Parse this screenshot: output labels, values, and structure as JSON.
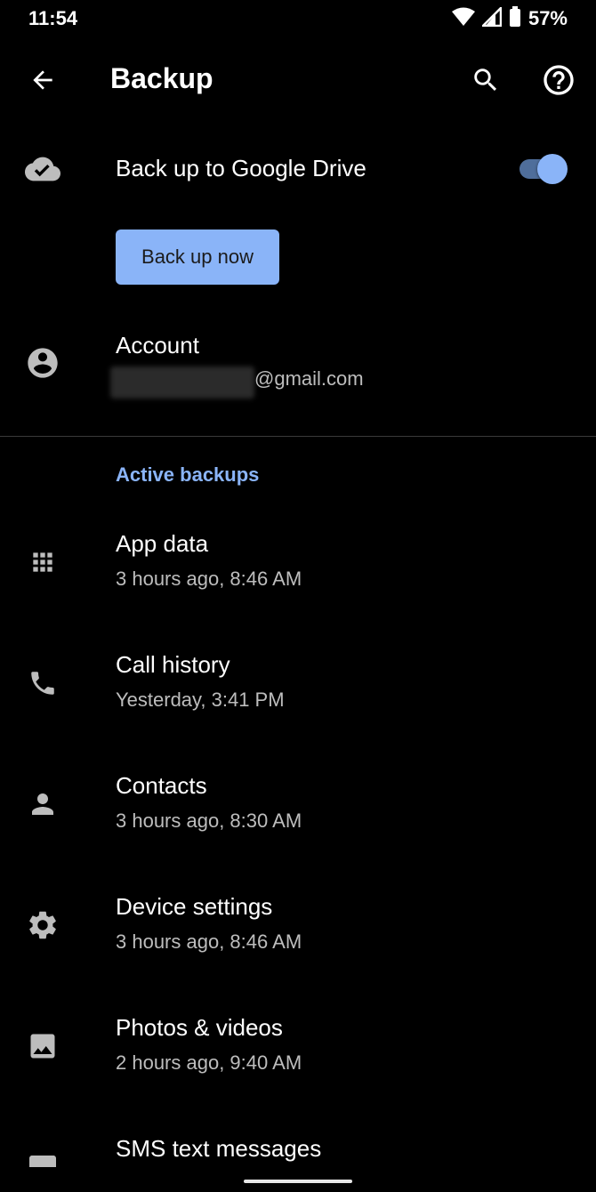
{
  "status_bar": {
    "time": "11:54",
    "battery": "57%"
  },
  "app_bar": {
    "title": "Backup"
  },
  "drive_backup": {
    "label": "Back up to Google Drive",
    "enabled": true
  },
  "backup_now": {
    "label": "Back up now"
  },
  "account": {
    "label": "Account",
    "email_suffix": "@gmail.com"
  },
  "section": {
    "header": "Active backups"
  },
  "backups": [
    {
      "name": "App data",
      "time": "3 hours ago, 8:46 AM",
      "icon": "apps-grid-icon"
    },
    {
      "name": "Call history",
      "time": "Yesterday, 3:41 PM",
      "icon": "phone-icon"
    },
    {
      "name": "Contacts",
      "time": "3 hours ago, 8:30 AM",
      "icon": "person-icon"
    },
    {
      "name": "Device settings",
      "time": "3 hours ago, 8:46 AM",
      "icon": "gear-icon"
    },
    {
      "name": "Photos & videos",
      "time": "2 hours ago, 9:40 AM",
      "icon": "image-icon"
    },
    {
      "name": "SMS text messages",
      "time": "",
      "icon": "sms-icon"
    }
  ],
  "colors": {
    "accent": "#8ab4f8",
    "background": "#000000",
    "secondary_text": "#bdbdbd"
  }
}
